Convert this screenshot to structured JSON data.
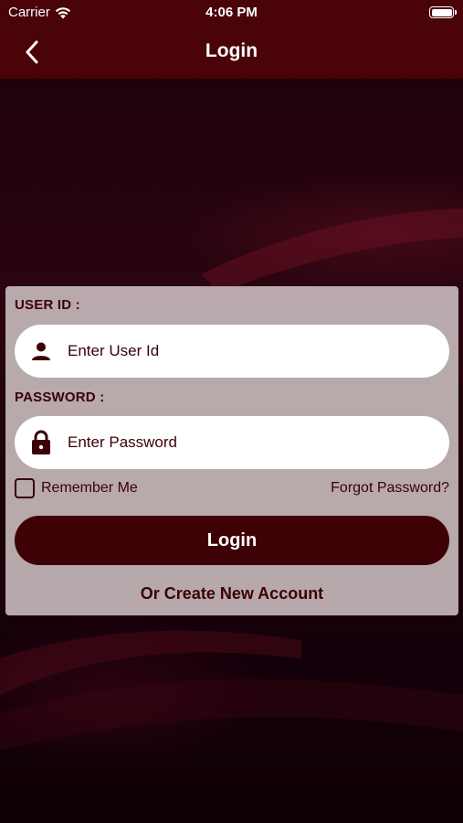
{
  "status_bar": {
    "carrier": "Carrier",
    "time": "4:06 PM"
  },
  "nav": {
    "title": "Login",
    "back_icon": "chevron-left-icon"
  },
  "form": {
    "user_id_label": "USER ID :",
    "user_id_placeholder": "Enter User Id",
    "user_icon": "person-icon",
    "password_label": "PASSWORD :",
    "password_placeholder": "Enter Password",
    "password_icon": "lock-icon",
    "remember_label": "Remember Me",
    "remember_checked": false,
    "forgot_label": "Forgot Password?",
    "login_label": "Login",
    "create_label": "Or Create New Account"
  },
  "colors": {
    "header_bg": "#4a0308",
    "primary": "#3e0106",
    "card_bg": "#c4b6b8",
    "text": "#3a0006"
  }
}
